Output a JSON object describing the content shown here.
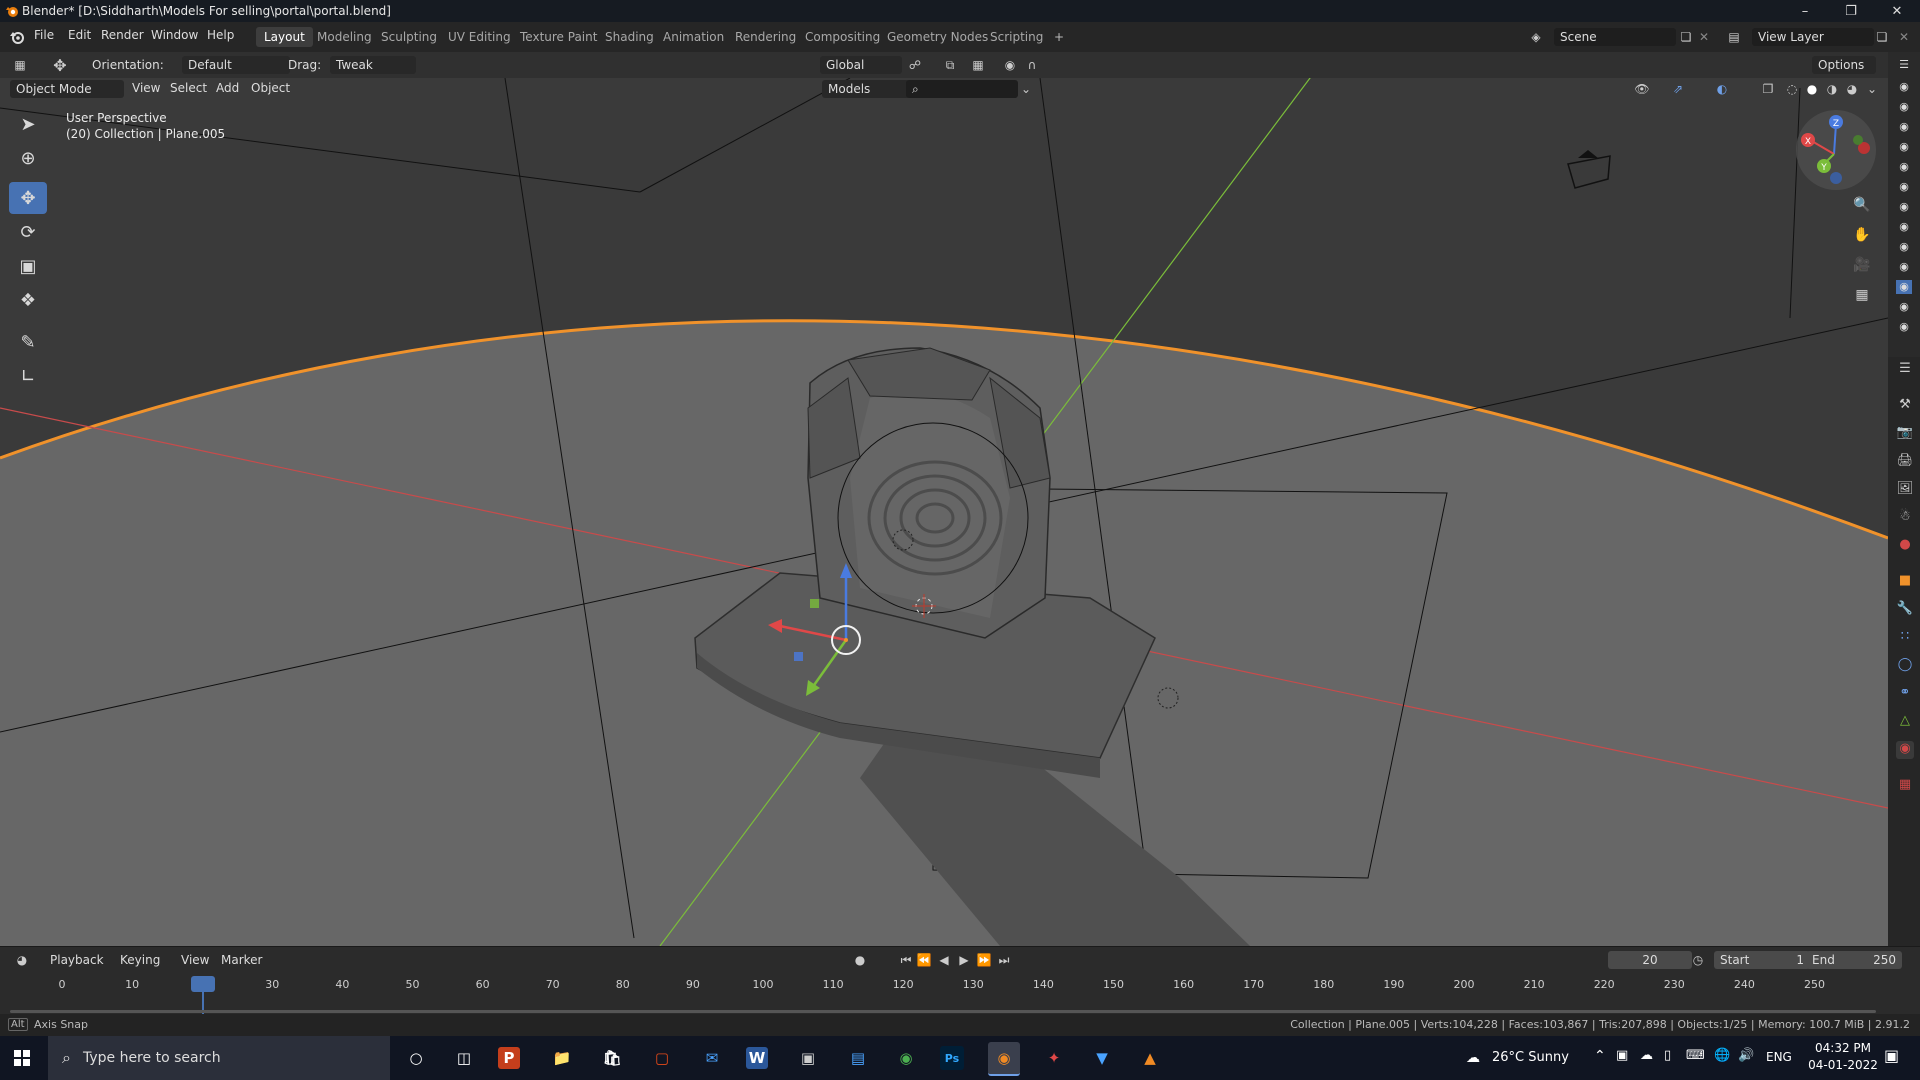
{
  "window": {
    "title": "Blender* [D:\\Siddharth\\Models For selling\\portal\\portal.blend]",
    "minimize": "–",
    "restore": "❐",
    "close": "✕"
  },
  "menu": {
    "items": [
      "File",
      "Edit",
      "Render",
      "Window",
      "Help"
    ]
  },
  "workspaces": {
    "tabs": [
      "Layout",
      "Modeling",
      "Sculpting",
      "UV Editing",
      "Texture Paint",
      "Shading",
      "Animation",
      "Rendering",
      "Compositing",
      "Geometry Nodes",
      "Scripting"
    ],
    "add": "+",
    "active": "Layout"
  },
  "scene": {
    "name": "Scene",
    "view_layer": "View Layer"
  },
  "viewport_header": {
    "orientation_label": "Orientation:",
    "orientation_value": "Default",
    "drag_label": "Drag:",
    "drag_value": "Tweak",
    "transform_orientation": "Global",
    "options": "Options",
    "mode": "Object Mode",
    "view": "View",
    "select": "Select",
    "add": "Add",
    "object": "Object",
    "collection_filter": "Models"
  },
  "viewport": {
    "perspective": "User Perspective",
    "info": "(20) Collection | Plane.005"
  },
  "gizmo": {
    "x": "X",
    "y": "Y",
    "z": "Z"
  },
  "timeline": {
    "playback": "Playback",
    "keying": "Keying",
    "view": "View",
    "marker": "Marker",
    "current_frame": "20",
    "start_label": "Start",
    "start": "1",
    "end_label": "End",
    "end": "250",
    "ticks": [
      "0",
      "10",
      "20",
      "30",
      "40",
      "50",
      "60",
      "70",
      "80",
      "90",
      "100",
      "110",
      "120",
      "130",
      "140",
      "150",
      "160",
      "170",
      "180",
      "190",
      "200",
      "210",
      "220",
      "230",
      "240",
      "250"
    ]
  },
  "statusbar": {
    "left_key": "Alt",
    "left": "Axis Snap",
    "right": "Collection | Plane.005 | Verts:104,228 | Faces:103,867 | Tris:207,898 | Objects:1/25 | Memory: 100.7 MiB | 2.91.2"
  },
  "taskbar": {
    "search_placeholder": "Type here to search",
    "weather": "26°C  Sunny",
    "lang": "ENG",
    "time": "04:32 PM",
    "date": "04-01-2022",
    "apps": [
      "P",
      "W",
      "Ps"
    ]
  },
  "colors": {
    "accent": "#4772b3",
    "selection_orange": "#f0922b",
    "axis_red": "#d03c3c",
    "axis_green": "#7bbd3a"
  }
}
